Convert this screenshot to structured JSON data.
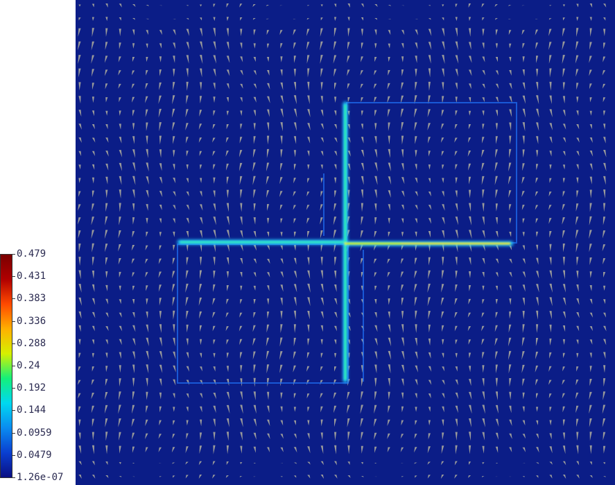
{
  "colorbar": {
    "ticks": [
      "0.479",
      "0.431",
      "0.383",
      "0.336",
      "0.288",
      "0.24",
      "0.192",
      "0.144",
      "0.0959",
      "0.0479",
      "1.26e-07"
    ],
    "stops": [
      "#0a0f83",
      "#0a3fd0",
      "#0a8cf0",
      "#00d8f0",
      "#14f07a",
      "#d6f000",
      "#ffb000",
      "#ff4a00",
      "#b00000",
      "#7a0000"
    ]
  },
  "colors": {
    "background": "#0b1d87",
    "arrow": "#9a9a9a",
    "highlight_low": "#1fa2ff",
    "highlight_mid": "#24e0c8",
    "highlight_high": "#e8ee20"
  }
}
